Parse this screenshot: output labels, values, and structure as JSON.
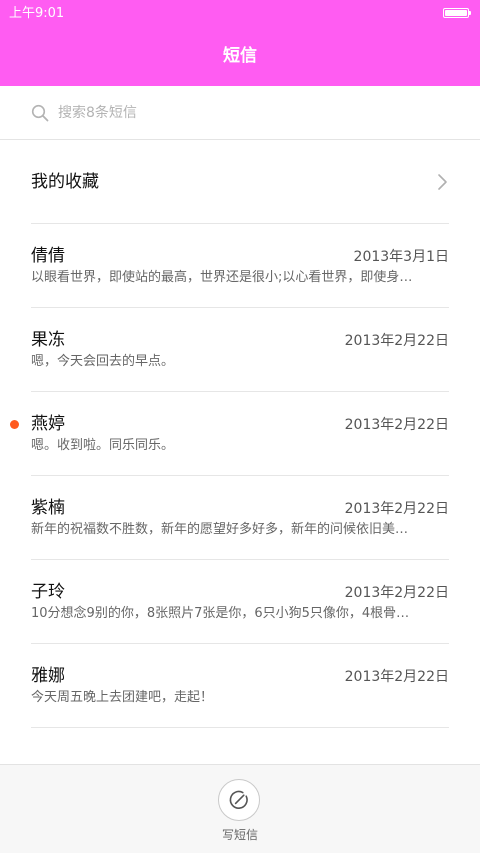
{
  "status_bar": {
    "time": "上午9:01",
    "battery_level": 1.0
  },
  "header": {
    "title": "短信",
    "background_color": "#ff5cf2"
  },
  "search": {
    "placeholder": "搜索8条短信",
    "icon": "search-icon"
  },
  "favorites": {
    "label": "我的收藏",
    "icon": "chevron-right-icon"
  },
  "conversations": [
    {
      "name": "倩倩",
      "date": "2013年3月1日",
      "preview": "以眼看世界，即使站的最高，世界还是很小;以心看世界，即使身…",
      "unread": false
    },
    {
      "name": "果冻",
      "date": "2013年2月22日",
      "preview": "嗯，今天会回去的早点。",
      "unread": false
    },
    {
      "name": "燕婷",
      "date": "2013年2月22日",
      "preview": "嗯。收到啦。同乐同乐。",
      "unread": true
    },
    {
      "name": "紫楠",
      "date": "2013年2月22日",
      "preview": "新年的祝福数不胜数，新年的愿望好多好多，新年的问候依旧美…",
      "unread": false
    },
    {
      "name": "子玲",
      "date": "2013年2月22日",
      "preview": "10分想念9别的你，8张照片7张是你，6只小狗5只像你，4根骨…",
      "unread": false
    },
    {
      "name": "雅娜",
      "date": "2013年2月22日",
      "preview": "今天周五晚上去团建吧，走起！",
      "unread": false
    }
  ],
  "unread_color": "#ff5a1f",
  "compose": {
    "label": "写短信",
    "icon": "compose-icon"
  }
}
